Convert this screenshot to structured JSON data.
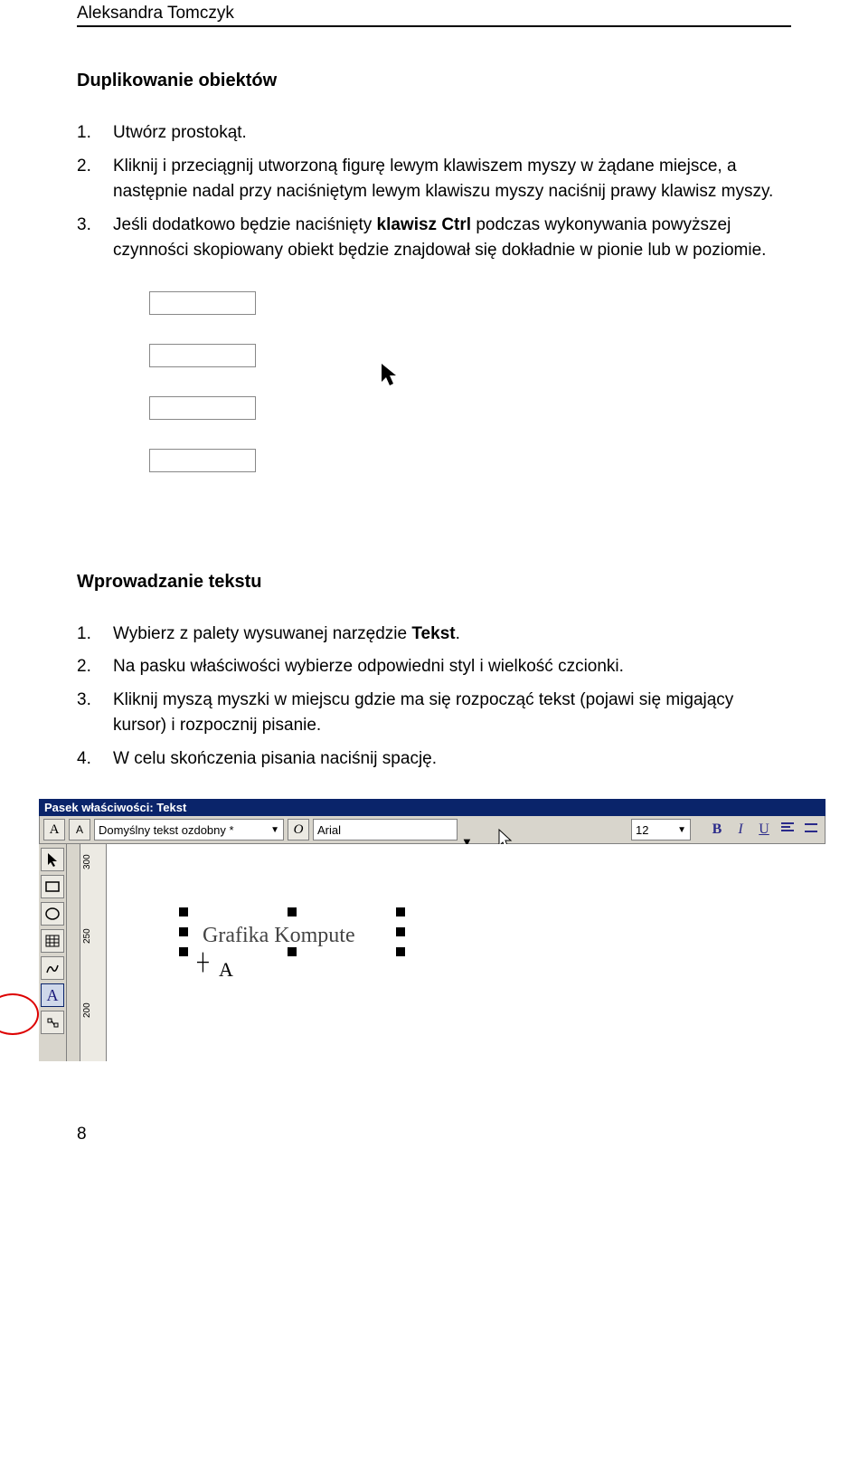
{
  "header": {
    "author": "Aleksandra Tomczyk"
  },
  "section1": {
    "title": "Duplikowanie obiektów",
    "items": [
      {
        "num": "1.",
        "text": "Utwórz prostokąt."
      },
      {
        "num": "2.",
        "text": "Kliknij i przeciągnij utworzoną figurę lewym klawiszem myszy w żądane miejsce, a następnie nadal przy naciśniętym lewym klawiszu myszy naciśnij prawy klawisz myszy."
      },
      {
        "num": "3.",
        "text_before": "Jeśli dodatkowo będzie naciśnięty ",
        "bold": "klawisz Ctrl",
        "text_after": " podczas wykonywania powyższej czynności skopiowany obiekt będzie znajdował się dokładnie w pionie lub w poziomie."
      }
    ]
  },
  "section2": {
    "title": "Wprowadzanie tekstu",
    "items": [
      {
        "num": "1.",
        "text_before": "Wybierz z palety wysuwanej narzędzie ",
        "bold": "Tekst",
        "text_after": "."
      },
      {
        "num": "2.",
        "text": "Na pasku właściwości wybierze odpowiedni styl i wielkość czcionki."
      },
      {
        "num": "3.",
        "text": "Kliknij myszą myszki w miejscu gdzie ma się rozpocząć tekst (pojawi się migający kursor) i rozpocznij pisanie."
      },
      {
        "num": "4.",
        "text": "W celu skończenia pisania naciśnij spację."
      }
    ]
  },
  "propbar": {
    "title": "Pasek właściwości: Tekst",
    "A_icon": "A",
    "style_combo_icon": "A",
    "style_combo_value": "Domyślny tekst ozdobny *",
    "font_icon": "O",
    "font_value": "Arial",
    "size_value": "12",
    "btn_B": "B",
    "btn_I": "I",
    "btn_U": "U"
  },
  "ruler": {
    "v_labels": [
      "300",
      "250",
      "200"
    ]
  },
  "textobj": {
    "content": "Grafika Kompute",
    "cursor_glyph": "A",
    "cross": "┼"
  },
  "toolbox": {
    "pick": "↖",
    "shape": "▭",
    "ellipse": "◯",
    "poly": "▦",
    "curve": "〰",
    "text": "A",
    "other": "⌇"
  },
  "page_number": "8"
}
